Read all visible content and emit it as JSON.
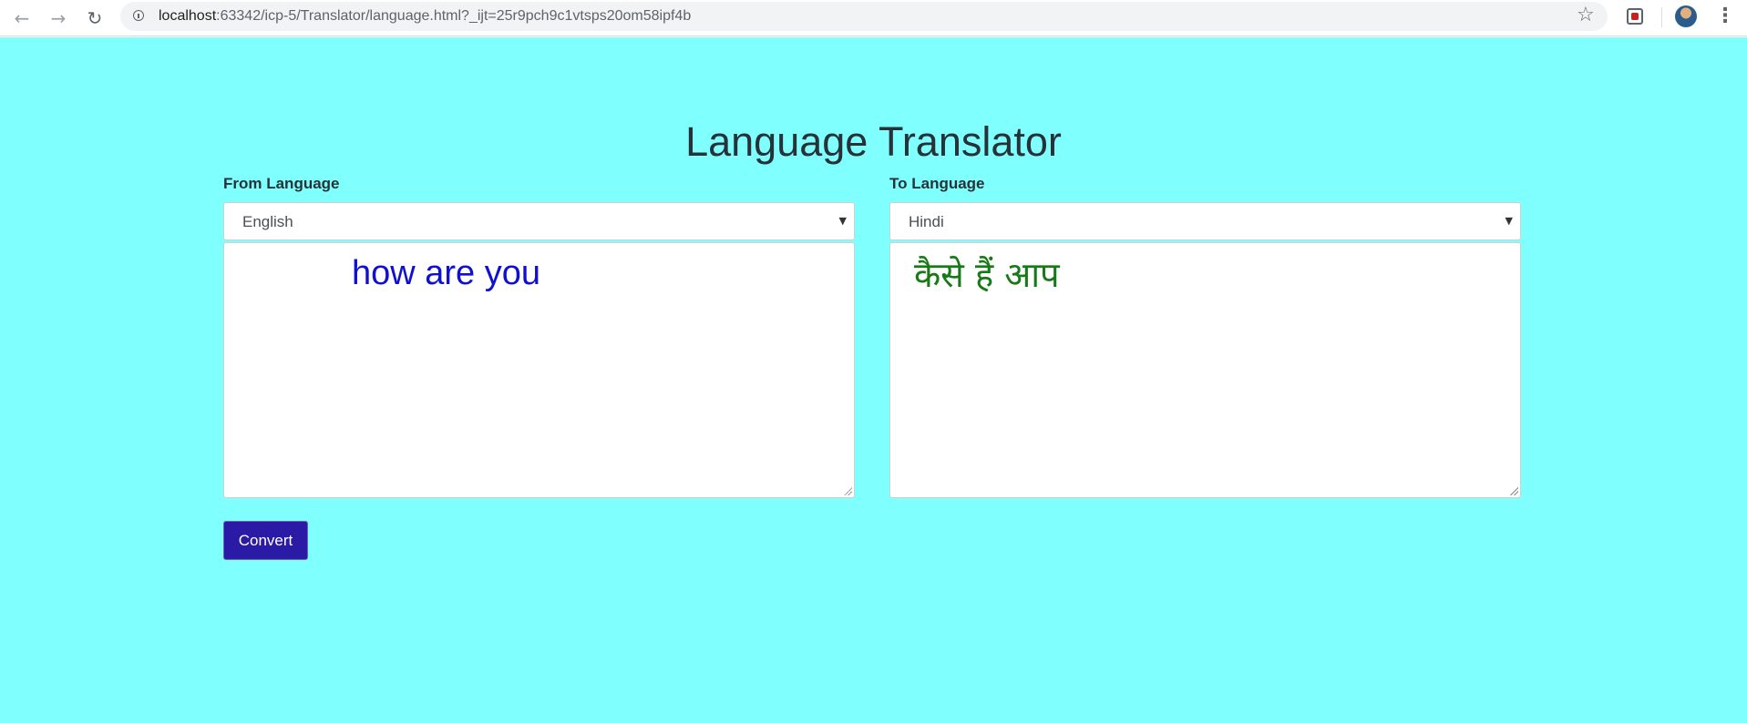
{
  "browser": {
    "url_host": "localhost",
    "url_rest": ":63342/icp-5/Translator/language.html?_ijt=25r9pch9c1vtsps20om58ipf4b"
  },
  "page": {
    "title": "Language Translator",
    "from": {
      "label": "From Language",
      "selected": "English",
      "text": "how are you"
    },
    "to": {
      "label": "To Language",
      "selected": "Hindi",
      "text": "कैसे हैं आप"
    },
    "convert_label": "Convert"
  },
  "colors": {
    "background": "#80ffff",
    "source_text": "#1010d0",
    "translated_text": "#177a17",
    "button": "#2a1aa6"
  }
}
